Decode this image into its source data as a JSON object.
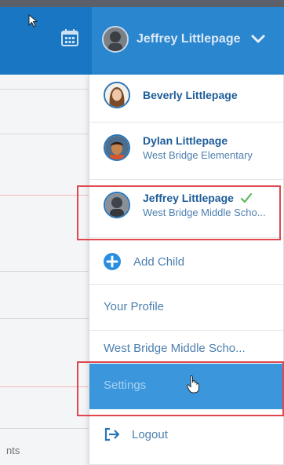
{
  "header": {
    "user_name": "Jeffrey Littlepage",
    "calendar_icon": "calendar-icon",
    "chevron_icon": "chevron-down-icon"
  },
  "menu": {
    "children": [
      {
        "name": "Beverly Littlepage",
        "school": "",
        "selected": false
      },
      {
        "name": "Dylan Littlepage",
        "school": "West Bridge Elementary",
        "selected": false
      },
      {
        "name": "Jeffrey Littlepage",
        "school": "West Bridge Middle Scho...",
        "selected": true
      }
    ],
    "add_child": "Add Child",
    "your_profile": "Your Profile",
    "school_link": "West Bridge Middle Scho...",
    "settings": "Settings",
    "logout": "Logout"
  },
  "background": {
    "left_tail_text": "nts"
  },
  "colors": {
    "header": "#1976c2",
    "header_right": "#2a86cf",
    "settings_highlight": "#3b96dc",
    "link_text": "#4d7fae",
    "annotation_red": "#e0474f",
    "check_green": "#5cb85c"
  }
}
